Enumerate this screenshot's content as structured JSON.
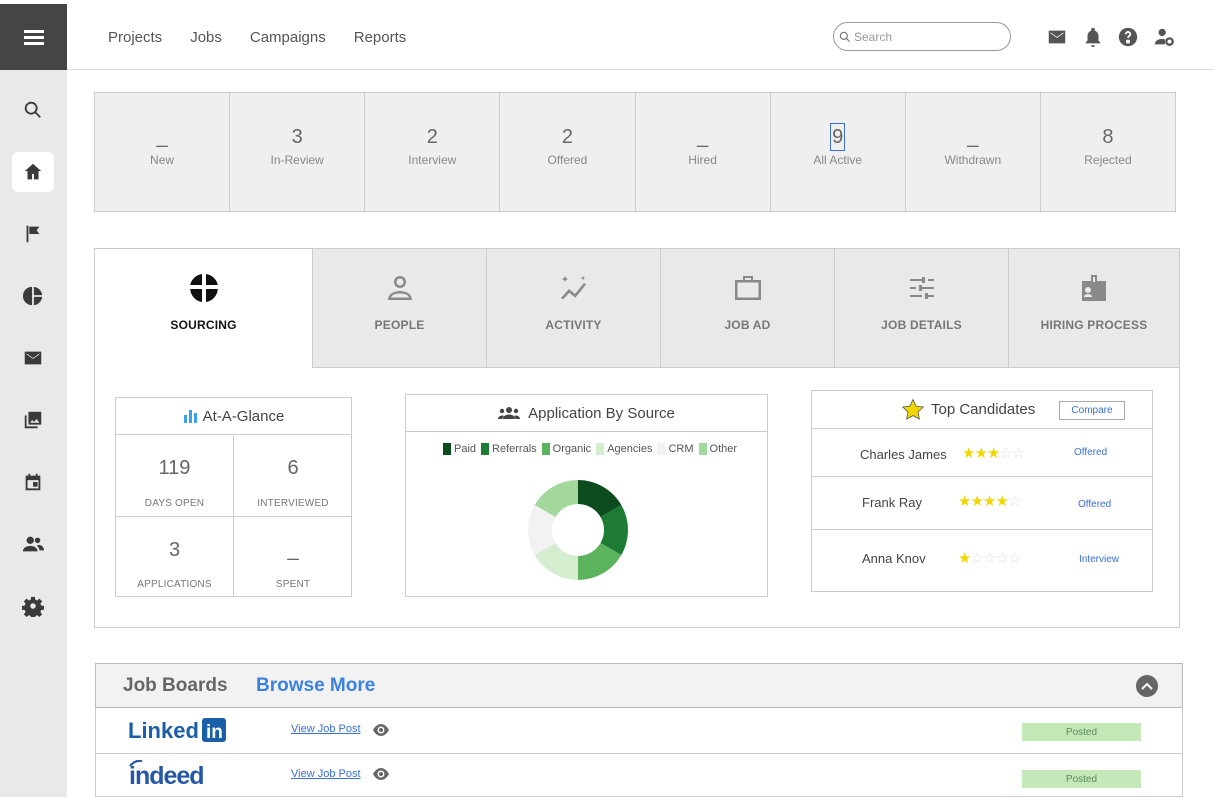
{
  "nav": {
    "links": [
      "Projects",
      "Jobs",
      "Campaigns",
      "Reports"
    ],
    "search_placeholder": "Search"
  },
  "sidebar": {
    "icons": [
      "menu-icon",
      "search-icon",
      "home-icon",
      "flag-icon",
      "pie-chart-icon",
      "mail-icon",
      "gallery-icon",
      "calendar-icon",
      "people-icon",
      "gear-icon"
    ],
    "active": "home-icon"
  },
  "topbar_icons": [
    "mail-icon",
    "bell-icon",
    "help-icon",
    "user-settings-icon"
  ],
  "pipeline": [
    {
      "value": "_",
      "label": "New"
    },
    {
      "value": "3",
      "label": "In-Review"
    },
    {
      "value": "2",
      "label": "Interview"
    },
    {
      "value": "2",
      "label": "Offered"
    },
    {
      "value": "_",
      "label": "Hired"
    },
    {
      "value": "9",
      "label": "All Active"
    },
    {
      "value": "_",
      "label": "Withdrawn"
    },
    {
      "value": "8",
      "label": "Rejected"
    }
  ],
  "tabs": [
    {
      "label": "SOURCING",
      "icon": "sourcing-icon",
      "active": true
    },
    {
      "label": "PEOPLE",
      "icon": "person-icon"
    },
    {
      "label": "ACTIVITY",
      "icon": "activity-icon"
    },
    {
      "label": "JOB AD",
      "icon": "briefcase-icon"
    },
    {
      "label": "JOB DETAILS",
      "icon": "sliders-icon"
    },
    {
      "label": "HIRING PROCESS",
      "icon": "badge-icon"
    }
  ],
  "glance": {
    "title": "At-A-Glance",
    "cells": [
      {
        "value": "119",
        "label": "DAYS OPEN"
      },
      {
        "value": "6",
        "label": "INTERVIEWED"
      },
      {
        "value": "3",
        "label": "APPLICATIONS"
      },
      {
        "value": "_",
        "label": "SPENT"
      }
    ]
  },
  "source": {
    "title": "Application By Source",
    "legend": [
      {
        "name": "Paid",
        "color": "#0b4b1e"
      },
      {
        "name": "Referrals",
        "color": "#1e7b34"
      },
      {
        "name": "Organic",
        "color": "#5cb35e"
      },
      {
        "name": "Agencies",
        "color": "#d4edcf"
      },
      {
        "name": "CRM",
        "color": "#f2f2f2"
      },
      {
        "name": "Other",
        "color": "#a3d89c"
      }
    ]
  },
  "candidates": {
    "title": "Top Candidates",
    "compare_label": "Compare",
    "list": [
      {
        "name": "Charles James",
        "rating": 3,
        "status": "Offered"
      },
      {
        "name": "Frank Ray",
        "rating": 4,
        "status": "Offered"
      },
      {
        "name": "Anna Knov",
        "rating": 1,
        "status": "Interview"
      }
    ]
  },
  "boards": {
    "title": "Job Boards",
    "browse_label": "Browse More",
    "rows": [
      {
        "logo": "LinkedIn",
        "link": "View Job Post",
        "status": "Posted"
      },
      {
        "logo": "indeed",
        "link": "View Job Post",
        "status": "Posted"
      }
    ]
  },
  "chart_data": {
    "type": "pie",
    "categories": [
      "Paid",
      "Referrals",
      "Organic",
      "Agencies",
      "CRM",
      "Other"
    ],
    "values": [
      1,
      1,
      1,
      1,
      1,
      1
    ]
  }
}
